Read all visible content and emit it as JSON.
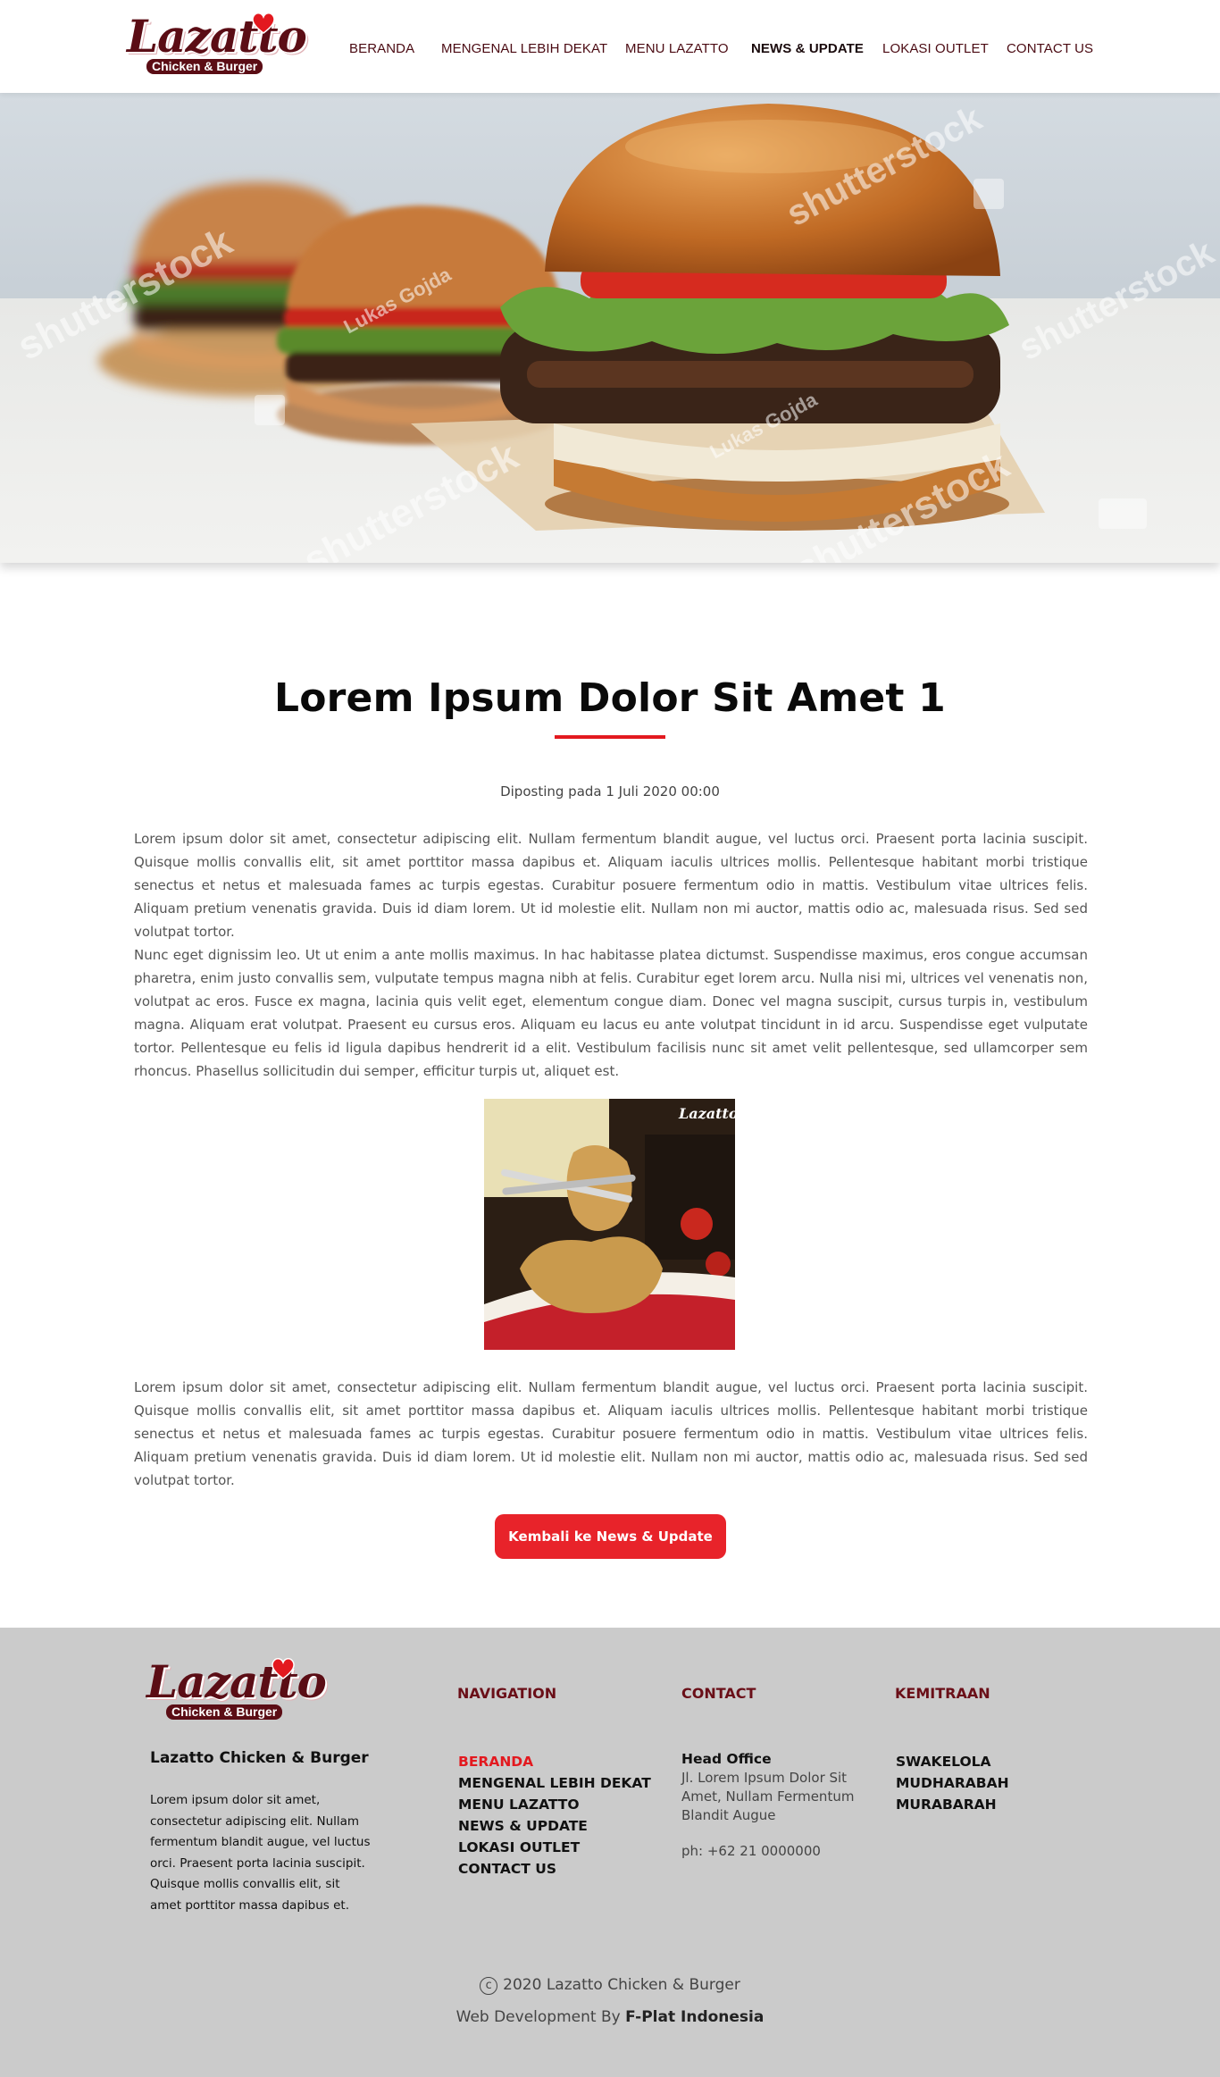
{
  "brand": {
    "logo_text": "Lazatto",
    "logo_subtext": "Chicken & Burger",
    "colors": {
      "primary_red": "#e3191f",
      "maroon": "#5b0d15",
      "footer_bg": "#cbcbcb"
    }
  },
  "nav": {
    "items": [
      {
        "label": "BERANDA",
        "active": false
      },
      {
        "label": "MENGENAL LEBIH DEKAT",
        "active": false
      },
      {
        "label": "MENU LAZATTO",
        "active": false
      },
      {
        "label": "NEWS & UPDATE",
        "active": true
      },
      {
        "label": "LOKASI OUTLET",
        "active": false
      },
      {
        "label": "CONTACT US",
        "active": false
      }
    ]
  },
  "hero": {
    "watermarks": [
      "shutterstock",
      "Lukas Gojda",
      "shutterstock",
      "Lukas Gojda",
      "shutterstock",
      "shutterstock",
      "shutterstock"
    ]
  },
  "article": {
    "title": "Lorem Ipsum Dolor Sit Amet 1",
    "posted": "Diposting pada 1 Juli 2020 00:00",
    "paragraphs": [
      "Lorem ipsum dolor sit amet, consectetur adipiscing elit. Nullam fermentum blandit augue, vel luctus orci. Praesent porta lacinia suscipit. Quisque mollis convallis elit, sit amet porttitor massa dapibus et. Aliquam iaculis ultrices mollis. Pellentesque habitant morbi tristique senectus et netus et malesuada fames ac turpis egestas. Curabitur posuere fermentum odio in mattis. Vestibulum vitae ultrices felis. Aliquam pretium venenatis gravida. Duis id diam lorem. Ut id molestie elit. Nullam non mi auctor, mattis odio ac, malesuada risus. Sed sed volutpat tortor.",
      "Nunc eget dignissim leo. Ut ut enim a ante mollis maximus. In hac habitasse platea dictumst. Suspendisse maximus, eros congue accumsan pharetra, enim justo convallis sem, vulputate tempus magna nibh at felis. Curabitur eget lorem arcu. Nulla nisi mi, ultrices vel venenatis non, volutpat ac eros. Fusce ex magna, lacinia quis velit eget, elementum congue diam. Donec vel magna suscipit, cursus turpis in, vestibulum magna. Aliquam erat volutpat. Praesent eu cursus eros. Aliquam eu lacus eu ante volutpat tincidunt in id arcu. Suspendisse eget vulputate tortor. Pellentesque eu felis id ligula dapibus hendrerit id a elit. Vestibulum facilisis nunc sit amet velit pellentesque, sed ullamcorper sem rhoncus. Phasellus sollicitudin dui semper, efficitur turpis ut, aliquet est.",
      "Lorem ipsum dolor sit amet, consectetur adipiscing elit. Nullam fermentum blandit augue, vel luctus orci. Praesent porta lacinia suscipit. Quisque mollis convallis elit, sit amet porttitor massa dapibus et. Aliquam iaculis ultrices mollis. Pellentesque habitant morbi tristique senectus et netus et malesuada fames ac turpis egestas. Curabitur posuere fermentum odio in mattis. Vestibulum vitae ultrices felis. Aliquam pretium venenatis gravida. Duis id diam lorem. Ut id molestie elit. Nullam non mi auctor, mattis odio ac, malesuada risus. Sed sed volutpat tortor."
    ],
    "image_logo": "Lazatto",
    "back_button": "Kembali ke News & Update"
  },
  "footer": {
    "brand_name": "Lazatto Chicken & Burger",
    "description": "Lorem ipsum dolor sit amet, consectetur adipiscing elit. Nullam fermentum blandit augue, vel luctus orci. Praesent porta lacinia suscipit. Quisque mollis convallis elit, sit amet porttitor massa dapibus et.",
    "navigation": {
      "heading": "NAVIGATION",
      "items": [
        {
          "label": "BERANDA",
          "active": true
        },
        {
          "label": "MENGENAL LEBIH DEKAT",
          "active": false
        },
        {
          "label": "MENU LAZATTO",
          "active": false
        },
        {
          "label": "NEWS & UPDATE",
          "active": false
        },
        {
          "label": "LOKASI OUTLET",
          "active": false
        },
        {
          "label": "CONTACT US",
          "active": false
        }
      ]
    },
    "contact": {
      "heading": "CONTACT",
      "office_label": "Head Office",
      "address": "Jl. Lorem Ipsum Dolor Sit Amet, Nullam Fermentum Blandit Augue",
      "phone": "ph: +62 21 0000000"
    },
    "kemitraan": {
      "heading": "KEMITRAAN",
      "items": [
        "SWAKELOLA",
        "MUDHARABAH",
        "MURABARAH"
      ]
    },
    "copyright": "2020 Lazatto Chicken & Burger",
    "dev_prefix": "Web Development By",
    "dev_name": "F-Plat Indonesia"
  }
}
